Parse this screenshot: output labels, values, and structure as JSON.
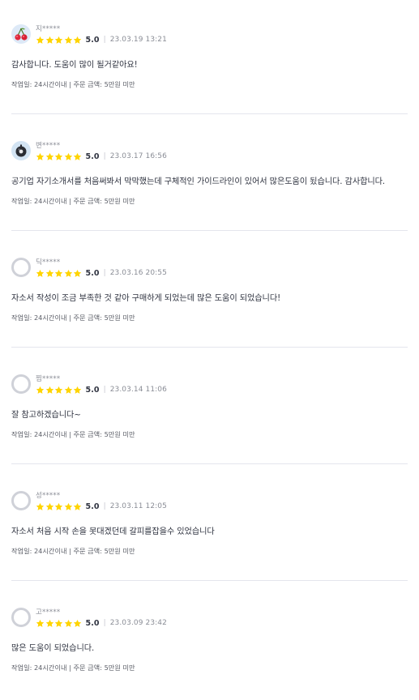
{
  "colors": {
    "star": "#ffd400",
    "divider": "#e4e5ed",
    "text": "#303441",
    "muted": "#8a8d96"
  },
  "reviews": [
    {
      "avatar": "cherry-avatar",
      "username": "지*****",
      "stars": 5,
      "rating": "5.0",
      "separator": "|",
      "date": "23.03.19 13:21",
      "content": "감사합니다. 도움이 많이 될거같아요!",
      "details": "작업일: 24시간이내 | 주문 금액: 5만원 미만"
    },
    {
      "avatar": "ball-avatar",
      "username": "변*****",
      "stars": 5,
      "rating": "5.0",
      "separator": "|",
      "date": "23.03.17 16:56",
      "content": "공기업 자기소개서를 처음써봐서 막막했는데 구체적인 가이드라인이 있어서 많은도움이 됬습니다. 감사합니다.",
      "details": "작업일: 24시간이내 | 주문 금액: 5만원 미만"
    },
    {
      "avatar": "default-avatar",
      "username": "딕*****",
      "stars": 5,
      "rating": "5.0",
      "separator": "|",
      "date": "23.03.16 20:55",
      "content": "자소서 작성이 조금 부족한 것 같아 구매하게 되었는데 많은 도움이 되었습니다!",
      "details": "작업일: 24시간이내 | 주문 금액: 5만원 미만"
    },
    {
      "avatar": "default-avatar",
      "username": "찜*****",
      "stars": 5,
      "rating": "5.0",
      "separator": "|",
      "date": "23.03.14 11:06",
      "content": "잘 참고하겠습니다~",
      "details": "작업일: 24시간이내 | 주문 금액: 5만원 미만"
    },
    {
      "avatar": "default-avatar",
      "username": "성*****",
      "stars": 5,
      "rating": "5.0",
      "separator": "|",
      "date": "23.03.11 12:05",
      "content": "자소서 처음 시작 손을 못대겠던데 갈피를잡을수 있었습니다",
      "details": "작업일: 24시간이내 | 주문 금액: 5만원 미만"
    },
    {
      "avatar": "default-avatar",
      "username": "고*****",
      "stars": 5,
      "rating": "5.0",
      "separator": "|",
      "date": "23.03.09 23:42",
      "content": "많은 도움이 되었습니다.",
      "details": "작업일: 24시간이내 | 주문 금액: 5만원 미만"
    }
  ]
}
